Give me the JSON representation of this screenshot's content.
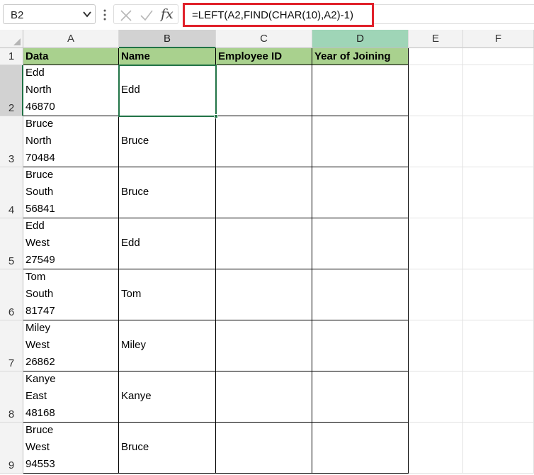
{
  "formula_bar": {
    "name_box": "B2",
    "formula": "=LEFT(A2,FIND(CHAR(10),A2)-1)",
    "icons": {
      "cancel": "close-icon",
      "enter": "checkmark-icon",
      "function": "fx-icon",
      "dropdown": "chevron-down-icon",
      "separator": "more-icon"
    },
    "fx_label": "fx"
  },
  "columns": [
    {
      "letter": "A",
      "state": "normal"
    },
    {
      "letter": "B",
      "state": "selected"
    },
    {
      "letter": "C",
      "state": "normal"
    },
    {
      "letter": "D",
      "state": "highlighted"
    },
    {
      "letter": "E",
      "state": "normal"
    },
    {
      "letter": "F",
      "state": "normal"
    }
  ],
  "header_row": {
    "number": "1",
    "cells": [
      "Data",
      "Name",
      "Employee ID",
      "Year of Joining"
    ]
  },
  "rows": [
    {
      "number": "2",
      "data": [
        "Edd",
        "North",
        "46870"
      ],
      "name": "Edd",
      "employee_id": "",
      "year": ""
    },
    {
      "number": "3",
      "data": [
        "Bruce",
        "North",
        "70484"
      ],
      "name": "Bruce",
      "employee_id": "",
      "year": ""
    },
    {
      "number": "4",
      "data": [
        "Bruce",
        "South",
        "56841"
      ],
      "name": "Bruce",
      "employee_id": "",
      "year": ""
    },
    {
      "number": "5",
      "data": [
        "Edd",
        "West",
        "27549"
      ],
      "name": "Edd",
      "employee_id": "",
      "year": ""
    },
    {
      "number": "6",
      "data": [
        "Tom",
        "South",
        "81747"
      ],
      "name": "Tom",
      "employee_id": "",
      "year": ""
    },
    {
      "number": "7",
      "data": [
        "Miley",
        "West",
        "26862"
      ],
      "name": "Miley",
      "employee_id": "",
      "year": ""
    },
    {
      "number": "8",
      "data": [
        "Kanye",
        "East",
        "48168"
      ],
      "name": "Kanye",
      "employee_id": "",
      "year": ""
    },
    {
      "number": "9",
      "data": [
        "Bruce",
        "West",
        "94553"
      ],
      "name": "Bruce",
      "employee_id": "",
      "year": ""
    }
  ],
  "selection": {
    "cell": "B2"
  },
  "colors": {
    "header_fill": "#a9d18e",
    "selection": "#217346",
    "formula_highlight": "#e0202a"
  }
}
